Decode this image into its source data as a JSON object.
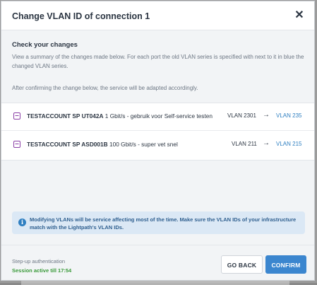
{
  "modal": {
    "title": "Change VLAN ID of connection 1",
    "close_icon": "close-icon"
  },
  "summary": {
    "heading": "Check your changes",
    "description": "View a summary of the changes made below. For each port the old VLAN series is specified with next to it in blue the changed VLAN series.",
    "note": "After confirming the change below, the service will be adapted accordingly."
  },
  "changes": [
    {
      "icon": "service-icon",
      "name": "TESTACCOUNT SP UT042A",
      "detail": " 1 Gbit/s - gebruik voor Self-service testen",
      "old_vlan": "VLAN 2301",
      "arrow": "→",
      "new_vlan": "VLAN 235"
    },
    {
      "icon": "service-icon",
      "name": "TESTACCOUNT SP ASD001B",
      "detail": " 100 Gbit/s - super vet snel",
      "old_vlan": "VLAN 211",
      "arrow": "→",
      "new_vlan": "VLAN 215"
    }
  ],
  "notice": {
    "icon": "info-icon",
    "text": "Modifying VLANs will be service affecting most of the time. Make sure the VLAN IDs of your infrastructure match with the Lightpath's VLAN IDs."
  },
  "footer": {
    "auth_label": "Step-up authentication",
    "auth_status": "Session active till 17:54",
    "back_label": "GO BACK",
    "confirm_label": "CONFIRM"
  },
  "colors": {
    "accent": "#3b86cf",
    "new_vlan": "#2f7fc1",
    "status_ok": "#3a9a3a",
    "service_icon": "#8b3fa6"
  }
}
